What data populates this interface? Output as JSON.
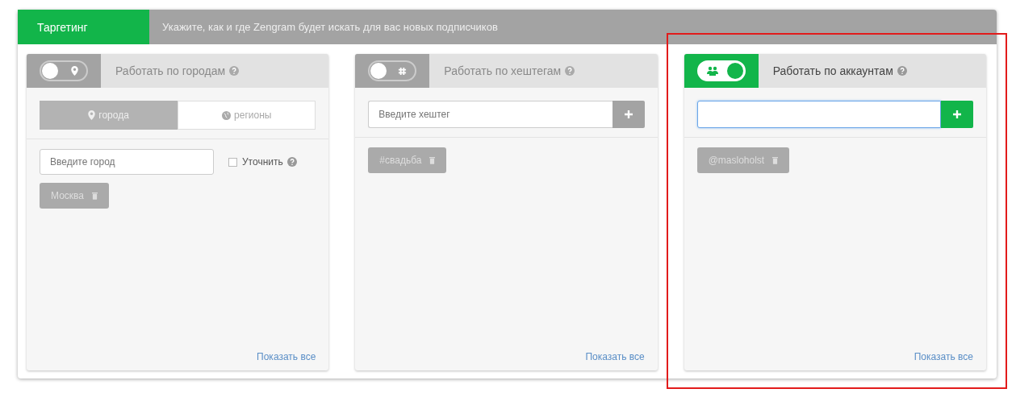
{
  "header": {
    "tab": "Таргетинг",
    "hint": "Укажите, как и где Zengram будет искать для вас новых подписчиков"
  },
  "panels": [
    {
      "kind": "cities",
      "on": false,
      "title": "Работать по городам",
      "tabs": [
        {
          "label": "города",
          "selected": true
        },
        {
          "label": "регионы",
          "selected": false
        }
      ],
      "input": {
        "placeholder": "Введите город"
      },
      "refine": {
        "label": "Уточнить",
        "checked": false
      },
      "tags": [
        "Москва"
      ],
      "link": "Показать все"
    },
    {
      "kind": "hashtags",
      "on": false,
      "title": "Работать по хештегам",
      "input": {
        "placeholder": "Введите хештег",
        "focused": false
      },
      "tags": [
        "#свадьба"
      ],
      "link": "Показать все"
    },
    {
      "kind": "accounts",
      "on": true,
      "title": "Работать по аккаунтам",
      "input": {
        "focused": true
      },
      "tags": [
        "@masloholst"
      ],
      "link": "Показать все"
    }
  ]
}
